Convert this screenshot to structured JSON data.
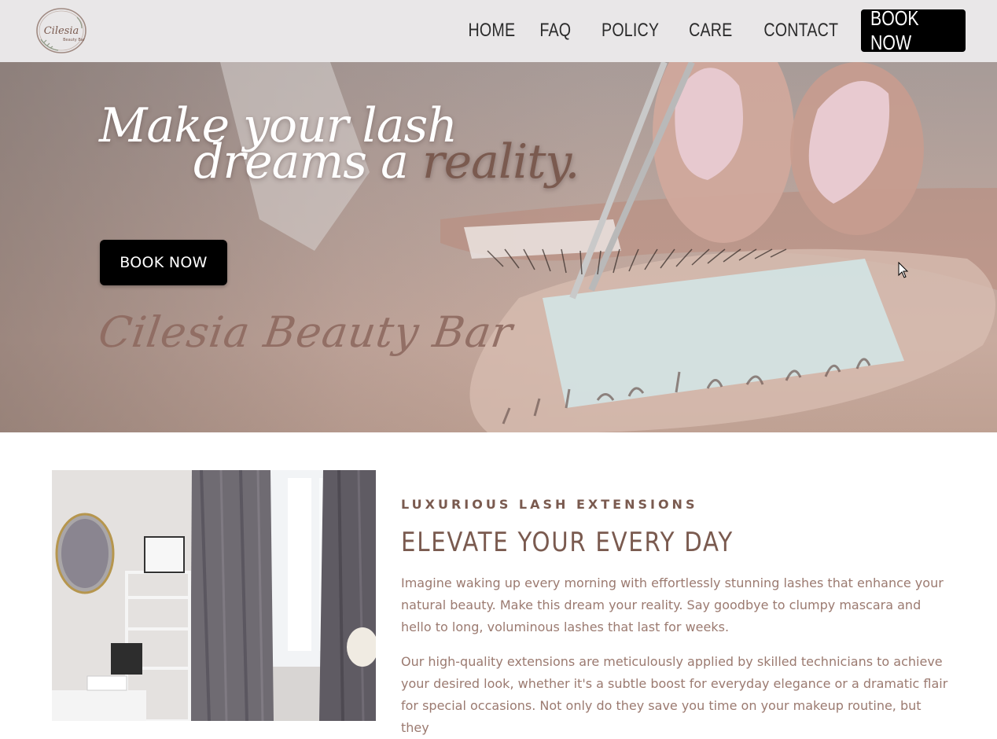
{
  "header": {
    "logo_text": "Cilesia Beauty Bar",
    "nav": [
      {
        "label": "HOME"
      },
      {
        "label": "FAQ"
      },
      {
        "label": "POLICY"
      },
      {
        "label": "CARE"
      },
      {
        "label": "CONTACT"
      }
    ],
    "book_label": "BOOK NOW"
  },
  "hero": {
    "title_line1": "Make your lash",
    "title_line2_prefix": "dreams a ",
    "title_line2_accent": "reality.",
    "book_label": "BOOK NOW",
    "script_text": "Cilesia Beauty Bar"
  },
  "about": {
    "eyebrow": "LUXURIOUS LASH EXTENSIONS",
    "headline": "ELEVATE YOUR EVERY DAY",
    "paragraph1": "Imagine waking up every morning with effortlessly stunning lashes that enhance your natural beauty. Make this dream your reality. Say goodbye to clumpy mascara and hello to long, voluminous lashes that last for weeks.",
    "paragraph2": "Our high-quality extensions are meticulously applied by skilled technicians to achieve your desired look, whether it's a subtle boost for everyday elegance or a dramatic flair for special occasions. Not only do they save you time on your makeup routine, but they"
  },
  "colors": {
    "header_bg": "#e9e7e8",
    "accent_brown": "#7a5a4f",
    "body_text": "#9b7a70",
    "button_bg": "#000000"
  },
  "icons": [
    "logo-wreath-icon",
    "cursor-icon"
  ]
}
